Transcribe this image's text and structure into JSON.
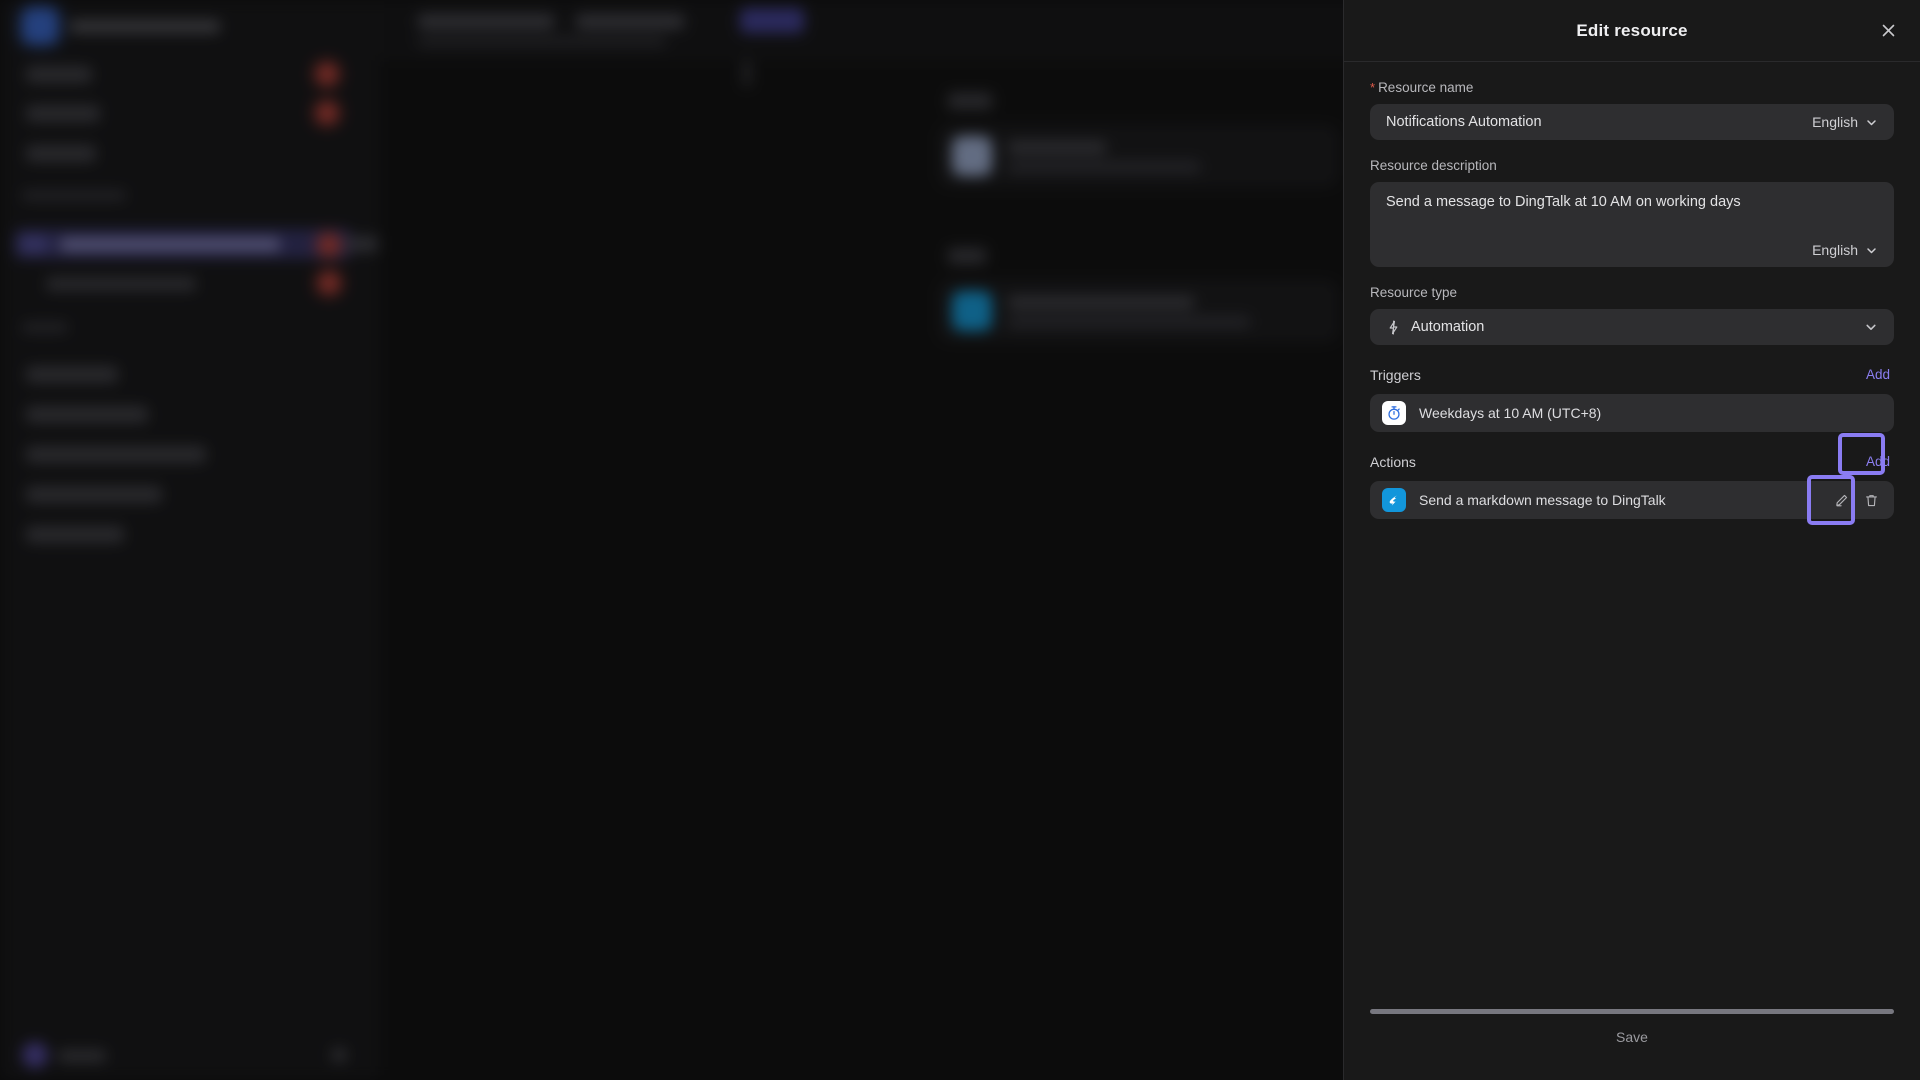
{
  "panel": {
    "title": "Edit resource",
    "close_icon": "close-icon",
    "fields": {
      "resource_name": {
        "label": "Resource name",
        "required_marker": "*",
        "value": "Notifications Automation",
        "language": "English",
        "chevron_icon": "chevron-down-icon"
      },
      "resource_description": {
        "label": "Resource description",
        "value": "Send a message to DingTalk at 10 AM on working days",
        "language": "English",
        "chevron_icon": "chevron-down-icon"
      },
      "resource_type": {
        "label": "Resource type",
        "value": "Automation",
        "icon": "lightning-bolt-icon",
        "chevron_icon": "chevron-down-icon"
      }
    },
    "triggers": {
      "title": "Triggers",
      "add_label": "Add",
      "items": [
        {
          "icon": "stopwatch-icon",
          "label": "Weekdays at 10 AM (UTC+8)"
        }
      ]
    },
    "actions": {
      "title": "Actions",
      "add_label": "Add",
      "items": [
        {
          "icon": "dingtalk-icon",
          "label": "Send a markdown message to DingTalk",
          "edit_icon": "pencil-icon",
          "delete_icon": "trash-icon"
        }
      ]
    },
    "footer": {
      "save_label": "Save"
    }
  },
  "annotations": {
    "highlight_color": "#8a7cf2",
    "boxes": [
      {
        "name": "actions-add-button",
        "label": "Add"
      },
      {
        "name": "action-edit-button",
        "label": "pencil-icon"
      }
    ]
  }
}
